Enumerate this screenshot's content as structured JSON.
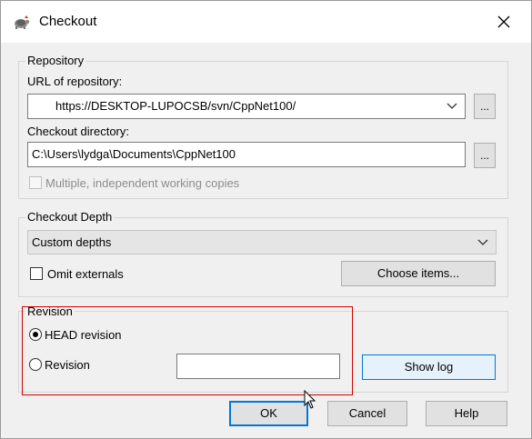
{
  "window": {
    "title": "Checkout",
    "title_icon": "tortoise-svn-icon",
    "close_icon": "close-icon"
  },
  "repository": {
    "group_title": "Repository",
    "url_label": "URL of repository:",
    "url_value": "https://DESKTOP-LUPOCSB/svn/CppNet100/",
    "url_browse_label": "...",
    "dir_label": "Checkout directory:",
    "dir_value": "C:\\Users\\lydga\\Documents\\CppNet100",
    "dir_browse_label": "...",
    "multiple_label": "Multiple, independent working copies",
    "multiple_checked": false
  },
  "depth": {
    "group_title": "Checkout Depth",
    "selected": "Custom depths",
    "omit_label": "Omit externals",
    "omit_checked": false,
    "choose_items_label": "Choose items..."
  },
  "revision": {
    "group_title": "Revision",
    "head_label": "HEAD revision",
    "head_selected": true,
    "revision_label": "Revision",
    "revision_value": "",
    "show_log_label": "Show log"
  },
  "buttons": {
    "ok": "OK",
    "cancel": "Cancel",
    "help": "Help"
  },
  "colors": {
    "highlight": "#d10000",
    "accent": "#0078d7"
  }
}
